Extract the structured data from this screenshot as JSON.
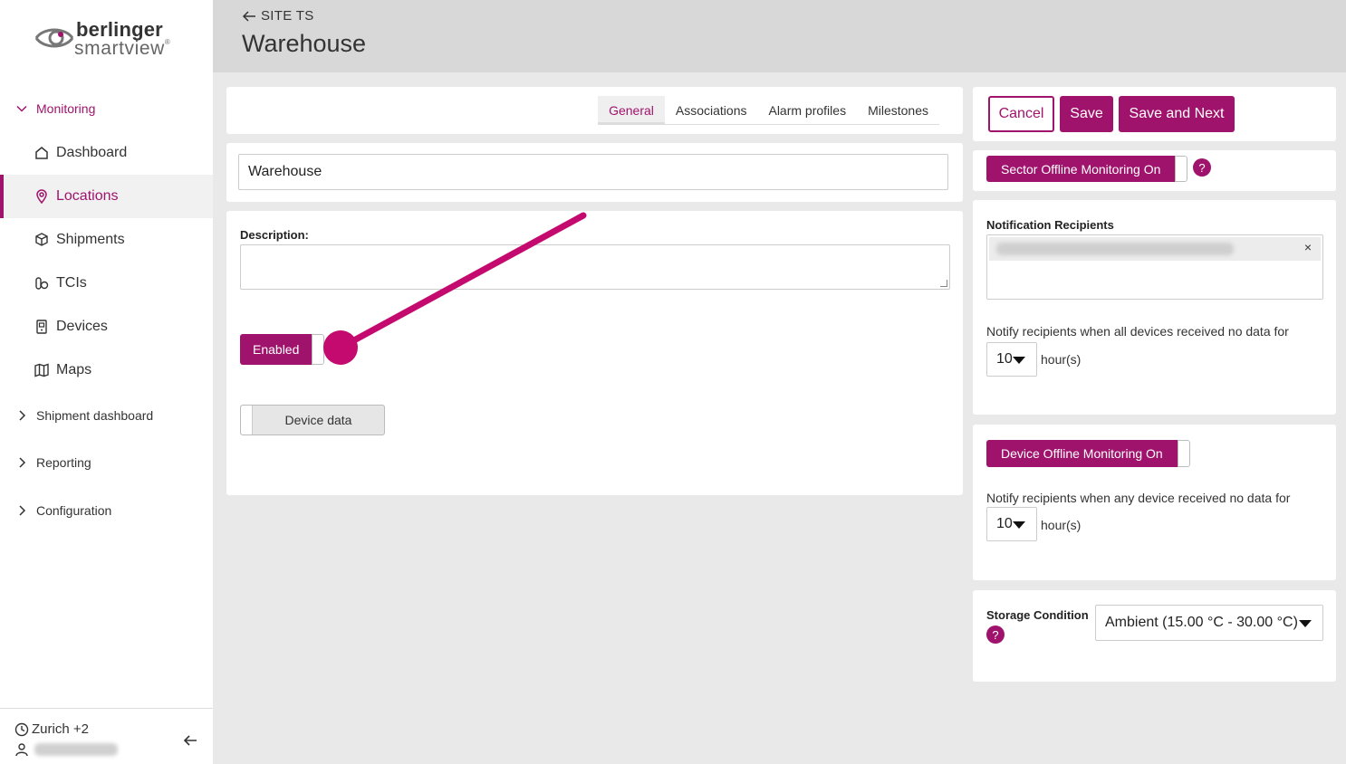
{
  "brand": {
    "line1": "berlinger",
    "line2": "smartview"
  },
  "sidebar": {
    "groups": [
      {
        "label": "Monitoring"
      },
      {
        "label": "Shipment dashboard"
      },
      {
        "label": "Reporting"
      },
      {
        "label": "Configuration"
      }
    ],
    "items": [
      {
        "label": "Dashboard",
        "icon": "home-icon"
      },
      {
        "label": "Locations",
        "icon": "location-pin-icon"
      },
      {
        "label": "Shipments",
        "icon": "box-icon"
      },
      {
        "label": "TCIs",
        "icon": "tci-icon"
      },
      {
        "label": "Devices",
        "icon": "device-icon"
      },
      {
        "label": "Maps",
        "icon": "map-icon"
      }
    ],
    "timezone": "Zurich +2"
  },
  "header": {
    "back_label": "SITE TS",
    "title": "Warehouse"
  },
  "tabs": [
    {
      "label": "General"
    },
    {
      "label": "Associations"
    },
    {
      "label": "Alarm profiles"
    },
    {
      "label": "Milestones"
    }
  ],
  "form": {
    "name_value": "Warehouse",
    "description_label": "Description:",
    "description_value": "",
    "enabled_label": "Enabled",
    "device_data_label": "Device data"
  },
  "actions": {
    "cancel": "Cancel",
    "save": "Save",
    "save_next": "Save and Next"
  },
  "sector": {
    "toggle_label": "Sector Offline Monitoring On",
    "help": "?",
    "recipients_label": "Notification Recipients",
    "chip_close": "×",
    "notify_text": "Notify recipients when all devices received no data for",
    "hours_value": "10",
    "hours_unit": "hour(s)"
  },
  "device": {
    "toggle_label": "Device Offline Monitoring On",
    "notify_text": "Notify recipients when any device received no data for",
    "hours_value": "10",
    "hours_unit": "hour(s)"
  },
  "storage": {
    "label": "Storage Condition",
    "help": "?",
    "value": "Ambient (15.00 °C - 30.00 °C)"
  },
  "colors": {
    "accent": "#a0136c",
    "header_bg": "#d8d8d8",
    "page_bg": "#e9e9e9"
  }
}
